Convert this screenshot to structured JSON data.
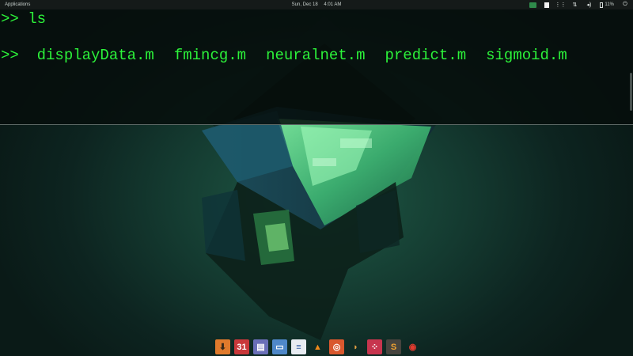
{
  "top_panel": {
    "applications_label": "Applications",
    "date": "Sun, Dec 18",
    "time": "4:01 AM",
    "battery_percent": "11%",
    "tray_icons": [
      "update-icon",
      "window-icon",
      "grid-icon",
      "network-icon",
      "volume-icon",
      "battery-icon",
      "power-icon"
    ]
  },
  "terminal": {
    "prompt": ">>",
    "command": "ls",
    "files": [
      "displayData.m",
      "fmincg.m",
      "neuralnet.m",
      "predict.m",
      "sigmoid.m"
    ],
    "text_color": "#2cf23a"
  },
  "dock": {
    "apps": [
      {
        "icon": "downloads-icon",
        "glyph": "⬇",
        "bg": "#e07a2c",
        "fg": "#3a2a1a",
        "running": true
      },
      {
        "icon": "calendar-icon",
        "glyph": "31",
        "bg": "#c9383a",
        "fg": "#ffffff",
        "running": false
      },
      {
        "icon": "file-manager-icon",
        "glyph": "▤",
        "bg": "#6a6fb8",
        "fg": "#ffffff",
        "running": false
      },
      {
        "icon": "window-manager-icon",
        "glyph": "▭",
        "bg": "#4f88c9",
        "fg": "#ffffff",
        "running": false
      },
      {
        "icon": "document-icon",
        "glyph": "≡",
        "bg": "#e8ecf2",
        "fg": "#3a62a8",
        "running": false
      },
      {
        "icon": "vlc-icon",
        "glyph": "▲",
        "bg": "transparent",
        "fg": "#f08a1c",
        "running": false
      },
      {
        "icon": "software-center-icon",
        "glyph": "◎",
        "bg": "#d9582e",
        "fg": "#ffffff",
        "running": false
      },
      {
        "icon": "peanut-icon",
        "glyph": "◗",
        "bg": "transparent",
        "fg": "#e4a244",
        "running": false
      },
      {
        "icon": "settings-dots-icon",
        "glyph": "⁘",
        "bg": "#c7354e",
        "fg": "#ffffff",
        "running": false
      },
      {
        "icon": "sublime-text-icon",
        "glyph": "S",
        "bg": "#47443e",
        "fg": "#f0a232",
        "running": true
      },
      {
        "icon": "chrome-icon",
        "glyph": "◉",
        "bg": "transparent",
        "fg": "#e33b2e",
        "running": false
      }
    ]
  }
}
